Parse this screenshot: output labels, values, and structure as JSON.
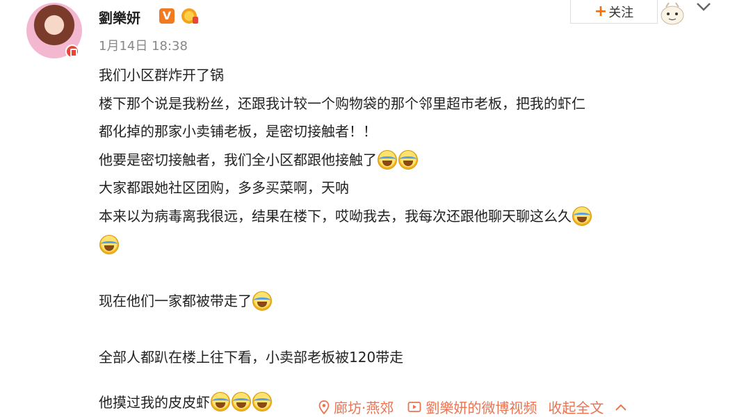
{
  "user": {
    "name": "劉樂妍",
    "verified_badge": "V",
    "timestamp": "1月14日 18:38"
  },
  "follow_button": {
    "plus": "+",
    "label": "关注"
  },
  "post": {
    "lines": [
      "我们小区群炸开了锅",
      "楼下那个说是我粉丝，还跟我计较一个购物袋的那个邻里超市老板，把我的虾仁",
      "都化掉的那家小卖铺老板，是密切接触者！！",
      "他要是密切接触者，我们全小区都跟他接触了",
      "大家都跟她社区团购，多多买菜啊，天呐",
      "本来以为病毒离我很远，结果在楼下，哎呦我去，我每次还跟他聊天聊这么久",
      "",
      "",
      "现在他们一家都被带走了",
      "",
      "全部人都趴在楼上往下看，小卖部老板被120带走",
      "",
      "他摸过我的皮皮虾"
    ]
  },
  "footer": {
    "location": "廊坊·燕郊",
    "video": "劉樂妍的微博视频",
    "collapse": "收起全文"
  },
  "icons": {
    "emoji": "laugh-cry-emoji",
    "location": "pin-icon",
    "video": "video-icon"
  },
  "colors": {
    "link": "#eb7350",
    "verified": "#f07b21",
    "follow_plus": "#ff6b00"
  }
}
